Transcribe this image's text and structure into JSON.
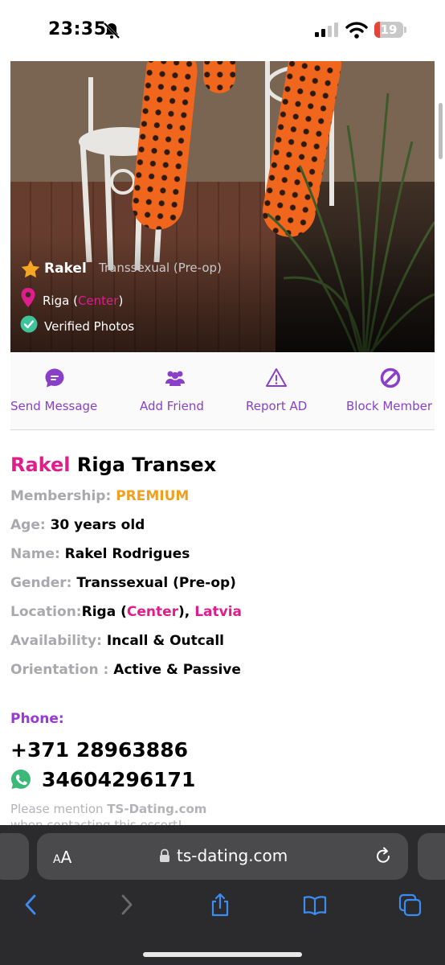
{
  "status_bar": {
    "time": "23:35",
    "battery": "19",
    "battery_level": 0.19,
    "icons": [
      "bell-slash-icon",
      "cellular-signal-icon",
      "wifi-icon",
      "battery-icon"
    ]
  },
  "hero": {
    "name": "Rakel",
    "gender": "Transsexual (Pre-op)",
    "city": "Riga",
    "district": "Center",
    "verified": "Verified Photos",
    "icons": [
      "star-icon",
      "location-pin-icon",
      "check-circle-icon"
    ]
  },
  "actions": [
    {
      "label": "Send Message",
      "icon": "chat-icon"
    },
    {
      "label": "Add Friend",
      "icon": "users-icon"
    },
    {
      "label": "Report AD",
      "icon": "warning-icon"
    },
    {
      "label": "Block Member",
      "icon": "block-icon"
    }
  ],
  "profile": {
    "title_accent": "Rakel",
    "title_rest": "Riga Transex",
    "membership_label": "Membership:",
    "membership_value": "PREMIUM",
    "age_label": "Age:",
    "age_value": "30 years old",
    "name_label": "Name:",
    "name_value": "Rakel Rodrigues",
    "gender_label": "Gender:",
    "gender_value": "Transsexual (Pre-op)",
    "location_label": "Location:",
    "location_city": "Riga",
    "location_district": "Center",
    "location_country": "Latvia",
    "availability_label": "Availability:",
    "availability_value": "Incall & Outcall",
    "orientation_label": "Orientation :",
    "orientation_value": "Active & Passive"
  },
  "contact": {
    "phone_label": "Phone:",
    "phone": "+371 28963886",
    "whatsapp": "34604296171",
    "mention_prefix": "Please mention",
    "mention_site": "TS-Dating.com",
    "mention_suffix": "when contacting this escort!"
  },
  "browser": {
    "aa_label": "AA",
    "url": "ts-dating.com",
    "tools": [
      "back-icon",
      "forward-icon",
      "share-icon",
      "bookmarks-icon",
      "tabs-icon"
    ]
  },
  "colors": {
    "accent_pink": "#e01d8c",
    "accent_purple": "#8a3fc8",
    "premium": "#f0a020",
    "muted": "#a8a8ad"
  }
}
